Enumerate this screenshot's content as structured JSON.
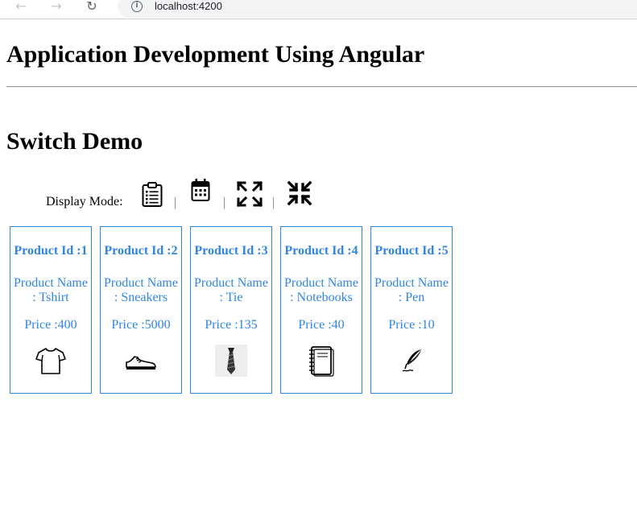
{
  "browser": {
    "back_glyph": "←",
    "forward_glyph": "→",
    "reload_glyph": "↻",
    "info_glyph": "i",
    "url": "localhost:4200"
  },
  "page": {
    "title": "Application Development Using Angular",
    "section_title": "Switch Demo"
  },
  "display_mode": {
    "label": "Display Mode:",
    "separator": "|",
    "icons": [
      "clipboard-list-icon",
      "calendar-icon",
      "expand-icon",
      "compress-icon"
    ]
  },
  "products": [
    {
      "id_label": "Product Id :1",
      "name_label": "Product Name : Tshirt",
      "price_label": "Price :400",
      "icon": "tshirt-icon"
    },
    {
      "id_label": "Product Id :2",
      "name_label": "Product Name : Sneakers",
      "price_label": "Price :5000",
      "icon": "sneaker-icon"
    },
    {
      "id_label": "Product Id :3",
      "name_label": "Product Name : Tie",
      "price_label": "Price :135",
      "icon": "tie-icon"
    },
    {
      "id_label": "Product Id :4",
      "name_label": "Product Name : Notebooks",
      "price_label": "Price :40",
      "icon": "notebook-icon"
    },
    {
      "id_label": "Product Id :5",
      "name_label": "Product Name : Pen",
      "price_label": "Price :10",
      "icon": "quill-pen-icon"
    }
  ],
  "colors": {
    "accent": "#2f86de",
    "divider": "#9a9a9a"
  }
}
